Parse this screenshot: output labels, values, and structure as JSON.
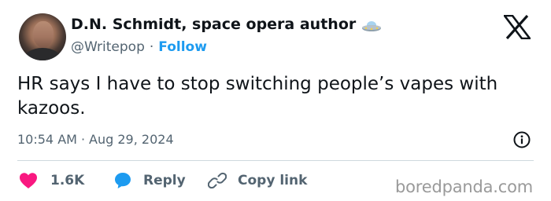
{
  "author": {
    "display_name": "D.N. Schmidt, space opera author",
    "badge_icon": "ufo-icon",
    "handle": "@Writepop",
    "separator": "·",
    "follow_label": "Follow"
  },
  "tweet": {
    "text": "HR says I have to stop switching people’s vapes with kazoos.",
    "time": "10:54 AM",
    "separator": "·",
    "date": "Aug 29, 2024"
  },
  "actions": {
    "like_count": "1.6K",
    "reply_label": "Reply",
    "copy_label": "Copy link"
  },
  "watermark": "boredpanda.com",
  "colors": {
    "accent": "#1d9bf0",
    "like": "#f91880",
    "text_primary": "#0f1419",
    "text_secondary": "#536471"
  },
  "icons": [
    "x-logo-icon",
    "info-icon",
    "heart-icon",
    "reply-bubble-icon",
    "link-icon",
    "ufo-icon"
  ]
}
